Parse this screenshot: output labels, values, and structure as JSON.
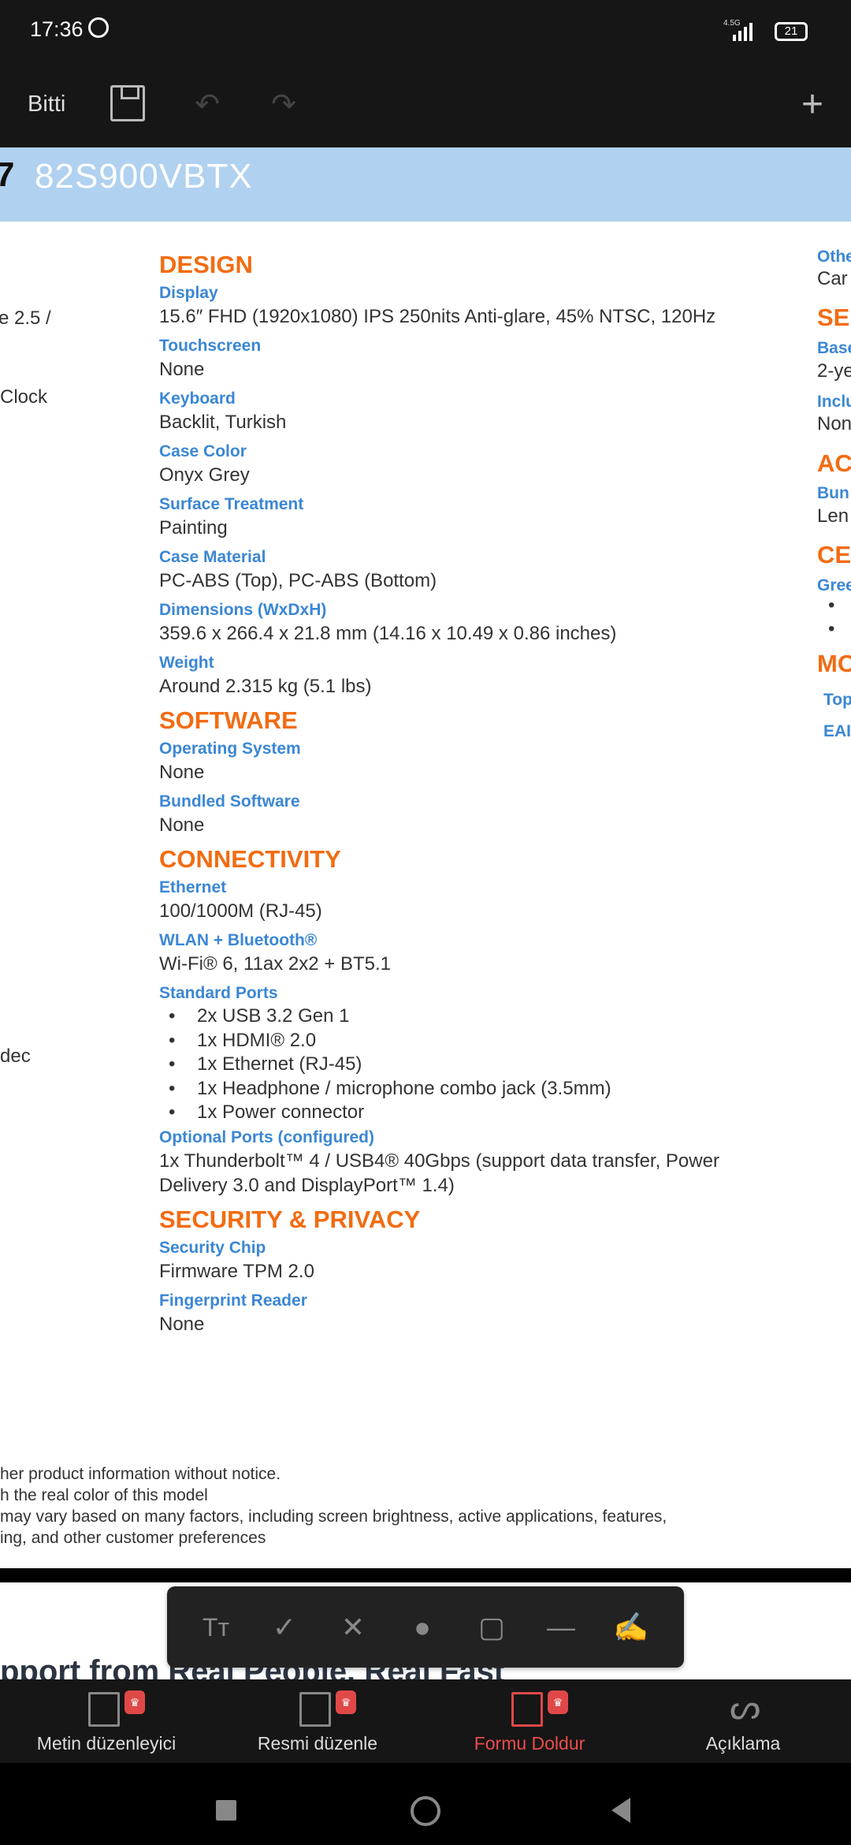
{
  "status": {
    "time": "17:36",
    "network": "4.5G",
    "battery": "21"
  },
  "toolbar": {
    "done": "Bitti"
  },
  "banner": {
    "prefix": "7",
    "model": "82S900VBTX"
  },
  "left_partial": [
    "e 2.5 /",
    "Clock",
    "dec"
  ],
  "sections": [
    {
      "title": "DESIGN",
      "items": [
        {
          "label": "Display",
          "value": "15.6″ FHD (1920x1080) IPS 250nits Anti-glare, 45% NTSC, 120Hz"
        },
        {
          "label": "Touchscreen",
          "value": "None"
        },
        {
          "label": "Keyboard",
          "value": "Backlit, Turkish"
        },
        {
          "label": "Case Color",
          "value": "Onyx Grey"
        },
        {
          "label": "Surface Treatment",
          "value": "Painting"
        },
        {
          "label": "Case Material",
          "value": "PC-ABS (Top), PC-ABS (Bottom)"
        },
        {
          "label": "Dimensions (WxDxH)",
          "value": "359.6 x 266.4 x 21.8 mm (14.16 x 10.49 x 0.86 inches)"
        },
        {
          "label": "Weight",
          "value": "Around 2.315 kg (5.1 lbs)"
        }
      ]
    },
    {
      "title": "SOFTWARE",
      "items": [
        {
          "label": "Operating System",
          "value": "None"
        },
        {
          "label": "Bundled Software",
          "value": "None"
        }
      ]
    },
    {
      "title": "CONNECTIVITY",
      "items": [
        {
          "label": "Ethernet",
          "value": "100/1000M (RJ-45)"
        },
        {
          "label": "WLAN + Bluetooth®",
          "value": "Wi-Fi® 6, 11ax 2x2 + BT5.1"
        },
        {
          "label": "Standard Ports",
          "bullets": [
            "2x USB 3.2 Gen 1",
            "1x HDMI® 2.0",
            "1x Ethernet (RJ-45)",
            "1x Headphone / microphone combo jack (3.5mm)",
            "1x Power connector"
          ]
        },
        {
          "label": "Optional Ports (configured)",
          "value": "1x Thunderbolt™ 4 / USB4® 40Gbps (support data transfer, Power Delivery 3.0 and DisplayPort™ 1.4)"
        }
      ]
    },
    {
      "title": "SECURITY & PRIVACY",
      "items": [
        {
          "label": "Security Chip",
          "value": "Firmware TPM 2.0"
        },
        {
          "label": "Fingerprint Reader",
          "value": "None"
        }
      ]
    }
  ],
  "right_partial": {
    "l1": "Othe",
    "v1": "Car",
    "h1": "SE",
    "l2": "Base",
    "v2": "2-ye",
    "l3": "Inclu",
    "v3": "Non",
    "h2": "AC",
    "l4": "Bun",
    "v4": "Len",
    "h3": "CE",
    "l5": "Gree",
    "h4": "MO",
    "l6": "Top",
    "l7": "EAI"
  },
  "footnotes": [
    "her product information without notice.",
    "h the real color of this model",
    " may vary based on many factors, including screen brightness, active applications, features,",
    "ing, and other customer preferences"
  ],
  "support_heading": "pport from Real People. Real Fast",
  "bottom_nav": [
    {
      "label": "Metin düzenleyici"
    },
    {
      "label": "Resmi düzenle"
    },
    {
      "label": "Formu Doldur",
      "active": true
    },
    {
      "label": "Açıklama"
    }
  ],
  "colors": {
    "accent": "#f26c12",
    "label": "#3b87d4",
    "active_tab": "#ec4c4c",
    "banner": "#b0d1ef"
  }
}
